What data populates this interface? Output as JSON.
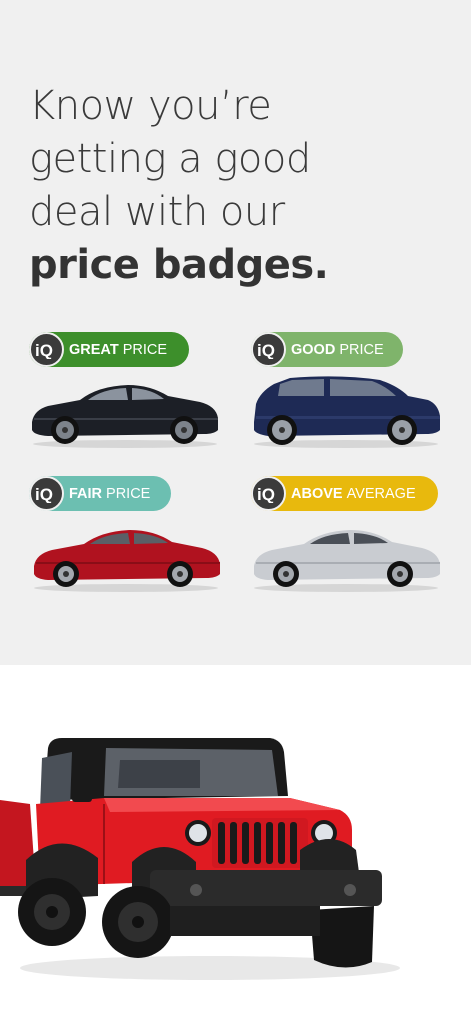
{
  "headline": {
    "line1": "Know you’re",
    "line2": "getting a good",
    "line3": "deal with our",
    "line4": "price badges."
  },
  "badges": [
    {
      "icon": "iq-logo-icon",
      "strong": "GREAT",
      "light": "PRICE",
      "color": "#3d8f2b"
    },
    {
      "icon": "iq-logo-icon",
      "strong": "GOOD",
      "light": "PRICE",
      "color": "#7fb46b"
    },
    {
      "icon": "iq-logo-icon",
      "strong": "FAIR",
      "light": "PRICE",
      "color": "#6cbfb1"
    },
    {
      "icon": "iq-logo-icon",
      "strong": "ABOVE",
      "light": "AVERAGE",
      "color": "#e8b90d"
    }
  ],
  "cars": [
    {
      "name": "black-sedan",
      "color": "#1c1f26"
    },
    {
      "name": "navy-suv",
      "color": "#1e2a55"
    },
    {
      "name": "red-sedan",
      "color": "#b0121f"
    },
    {
      "name": "silver-sedan",
      "color": "#c9ccd1"
    },
    {
      "name": "red-jeep",
      "color": "#e01b22"
    }
  ]
}
